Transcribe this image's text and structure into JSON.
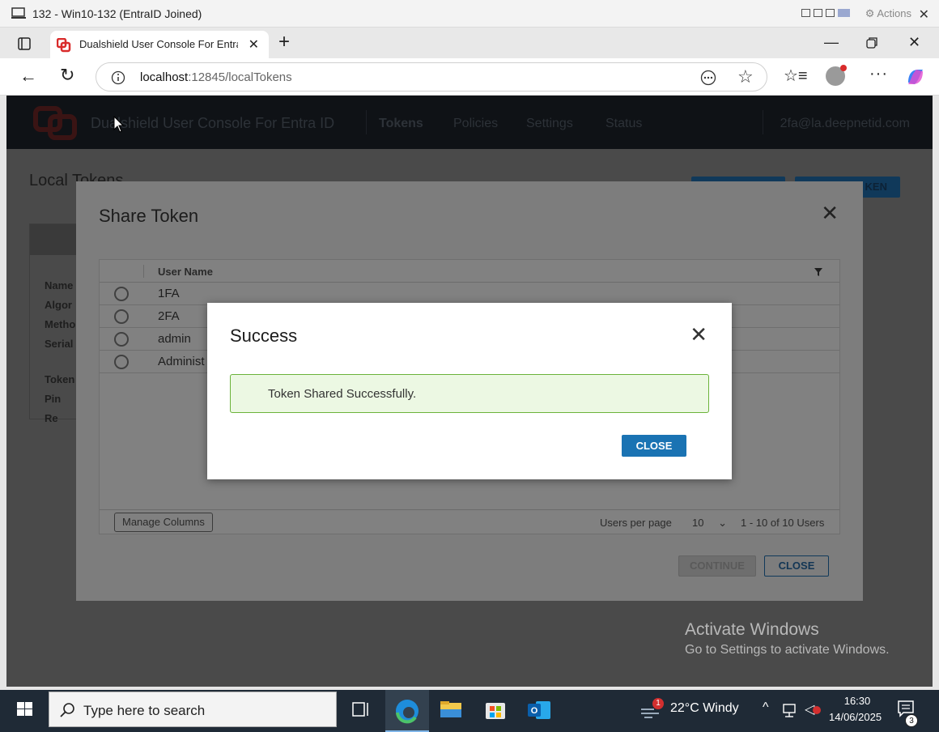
{
  "vm": {
    "title": "132 - Win10-132 (EntraID Joined)",
    "actions_label": "Actions"
  },
  "browser": {
    "tab_title": "Dualshield User Console For Entra ID",
    "url_host": "localhost",
    "url_rest": ":12845/localTokens"
  },
  "app": {
    "title": "Dualshield User Console For Entra ID",
    "nav": [
      "Tokens",
      "Policies",
      "Settings",
      "Status"
    ],
    "user_email": "2fa@la.deepnetid.com",
    "page_heading": "Local Tokens",
    "bg_button_2": "KEN",
    "bg_labels": [
      "Name",
      "Algor",
      "Metho",
      "Serial",
      "Token",
      "Pin Re"
    ]
  },
  "share_dialog": {
    "title": "Share Token",
    "column_header": "User Name",
    "rows": [
      "1FA",
      "2FA",
      "admin",
      "Administ"
    ],
    "manage_columns": "Manage Columns",
    "users_per_page_label": "Users per page",
    "users_per_page_value": "10",
    "range_text": "1 - 10 of 10 Users",
    "continue_label": "CONTINUE",
    "close_label": "CLOSE"
  },
  "success_dialog": {
    "title": "Success",
    "message": "Token Shared Successfully.",
    "close_label": "CLOSE"
  },
  "watermark": {
    "line1": "Activate Windows",
    "line2": "Go to Settings to activate Windows."
  },
  "taskbar": {
    "search_placeholder": "Type here to search",
    "weather": "22°C  Windy",
    "weather_badge": "1",
    "time": "16:30",
    "date": "14/06/2025",
    "notification_count": "3"
  },
  "colors": {
    "brand_red": "#d92b2b",
    "primary_blue": "#1a73b3",
    "success_border": "#6bb33a",
    "success_bg": "#ecf8e3"
  }
}
